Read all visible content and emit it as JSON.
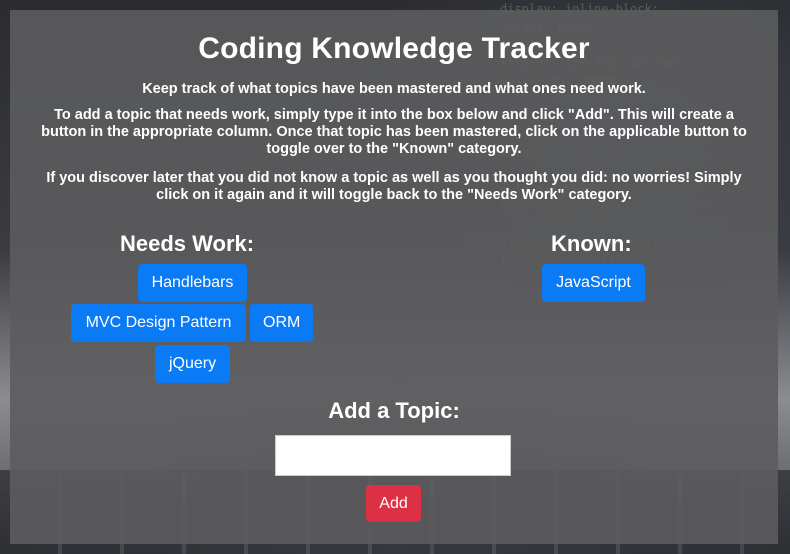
{
  "header": {
    "title": "Coding Knowledge Tracker"
  },
  "intro": {
    "line1": "Keep track of what topics have been mastered and what ones need work.",
    "line2": "To add a topic that needs work, simply type it into the box below and click \"Add\". This will create a button in the appropriate column. Once that topic has been mastered, click on the applicable button to toggle over to the \"Known\" category.",
    "line3": "If you discover later that you did not know a topic as well as you thought you did: no worries! Simply click on it again and it will toggle back to the \"Needs Work\" category."
  },
  "needs_work": {
    "title": "Needs Work:",
    "topics": [
      "Handlebars",
      "MVC Design Pattern",
      "ORM",
      "jQuery"
    ]
  },
  "known": {
    "title": "Known:",
    "topics": [
      "JavaScript"
    ]
  },
  "add_topic": {
    "title": "Add a Topic:",
    "input_value": "",
    "button_label": "Add"
  },
  "colors": {
    "topic_button": "#0a7bf5",
    "add_button": "#dc3045",
    "overlay": "#5c5c5e"
  }
}
